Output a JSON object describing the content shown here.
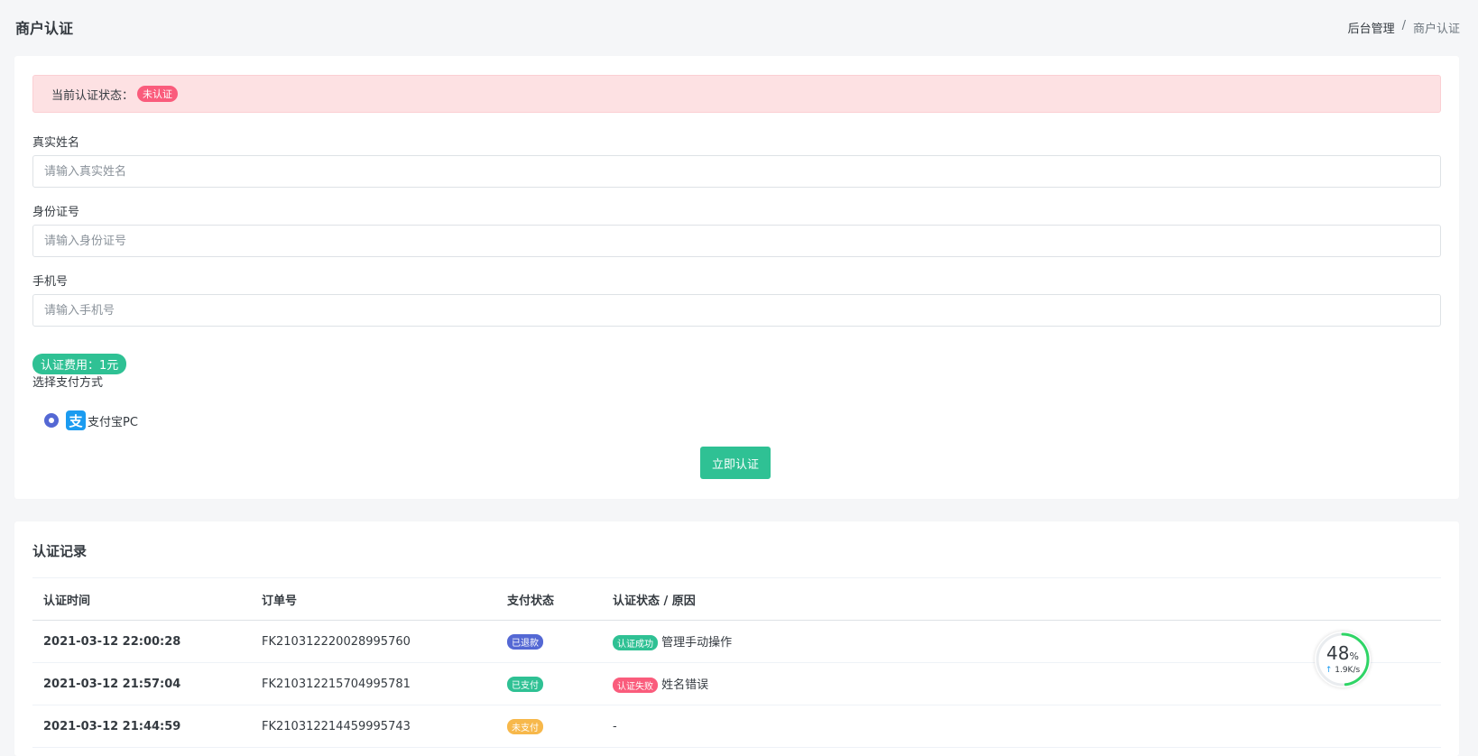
{
  "header": {
    "title": "商户认证",
    "breadcrumb": {
      "parent": "后台管理",
      "separator": "/",
      "current": "商户认证"
    }
  },
  "status": {
    "label": "当前认证状态：",
    "badge": "未认证"
  },
  "form": {
    "name": {
      "label": "真实姓名",
      "placeholder": "请输入真实姓名"
    },
    "idcard": {
      "label": "身份证号",
      "placeholder": "请输入身份证号"
    },
    "phone": {
      "label": "手机号",
      "placeholder": "请输入手机号"
    },
    "fee": "认证费用：1元",
    "payment": {
      "label": "选择支付方式",
      "option_icon": "支",
      "option": "支付宝PC"
    },
    "submit": "立即认证"
  },
  "records": {
    "title": "认证记录",
    "columns": [
      "认证时间",
      "订单号",
      "支付状态",
      "认证状态 / 原因"
    ],
    "rows": [
      {
        "time": "2021-03-12 22:00:28",
        "order": "FK210312220028995760",
        "pay": "已退款",
        "pay_color": "#5468d4",
        "auth": "认证成功",
        "auth_color": "#2fc194",
        "reason": "管理手动操作"
      },
      {
        "time": "2021-03-12 21:57:04",
        "order": "FK210312215704995781",
        "pay": "已支付",
        "pay_color": "#2fc194",
        "auth": "认证失败",
        "auth_color": "#fa5c7c",
        "reason": "姓名错误"
      },
      {
        "time": "2021-03-12 21:44:59",
        "order": "FK210312214459995743",
        "pay": "未支付",
        "pay_color": "#f7b84b",
        "auth": "",
        "auth_color": "",
        "reason": "-"
      }
    ]
  },
  "widget": {
    "percent": "48",
    "percent_unit": "%",
    "percent_value": 48,
    "rate_arrow": "↑",
    "rate": "1.9K/s",
    "ring_color": "#2fd566"
  }
}
